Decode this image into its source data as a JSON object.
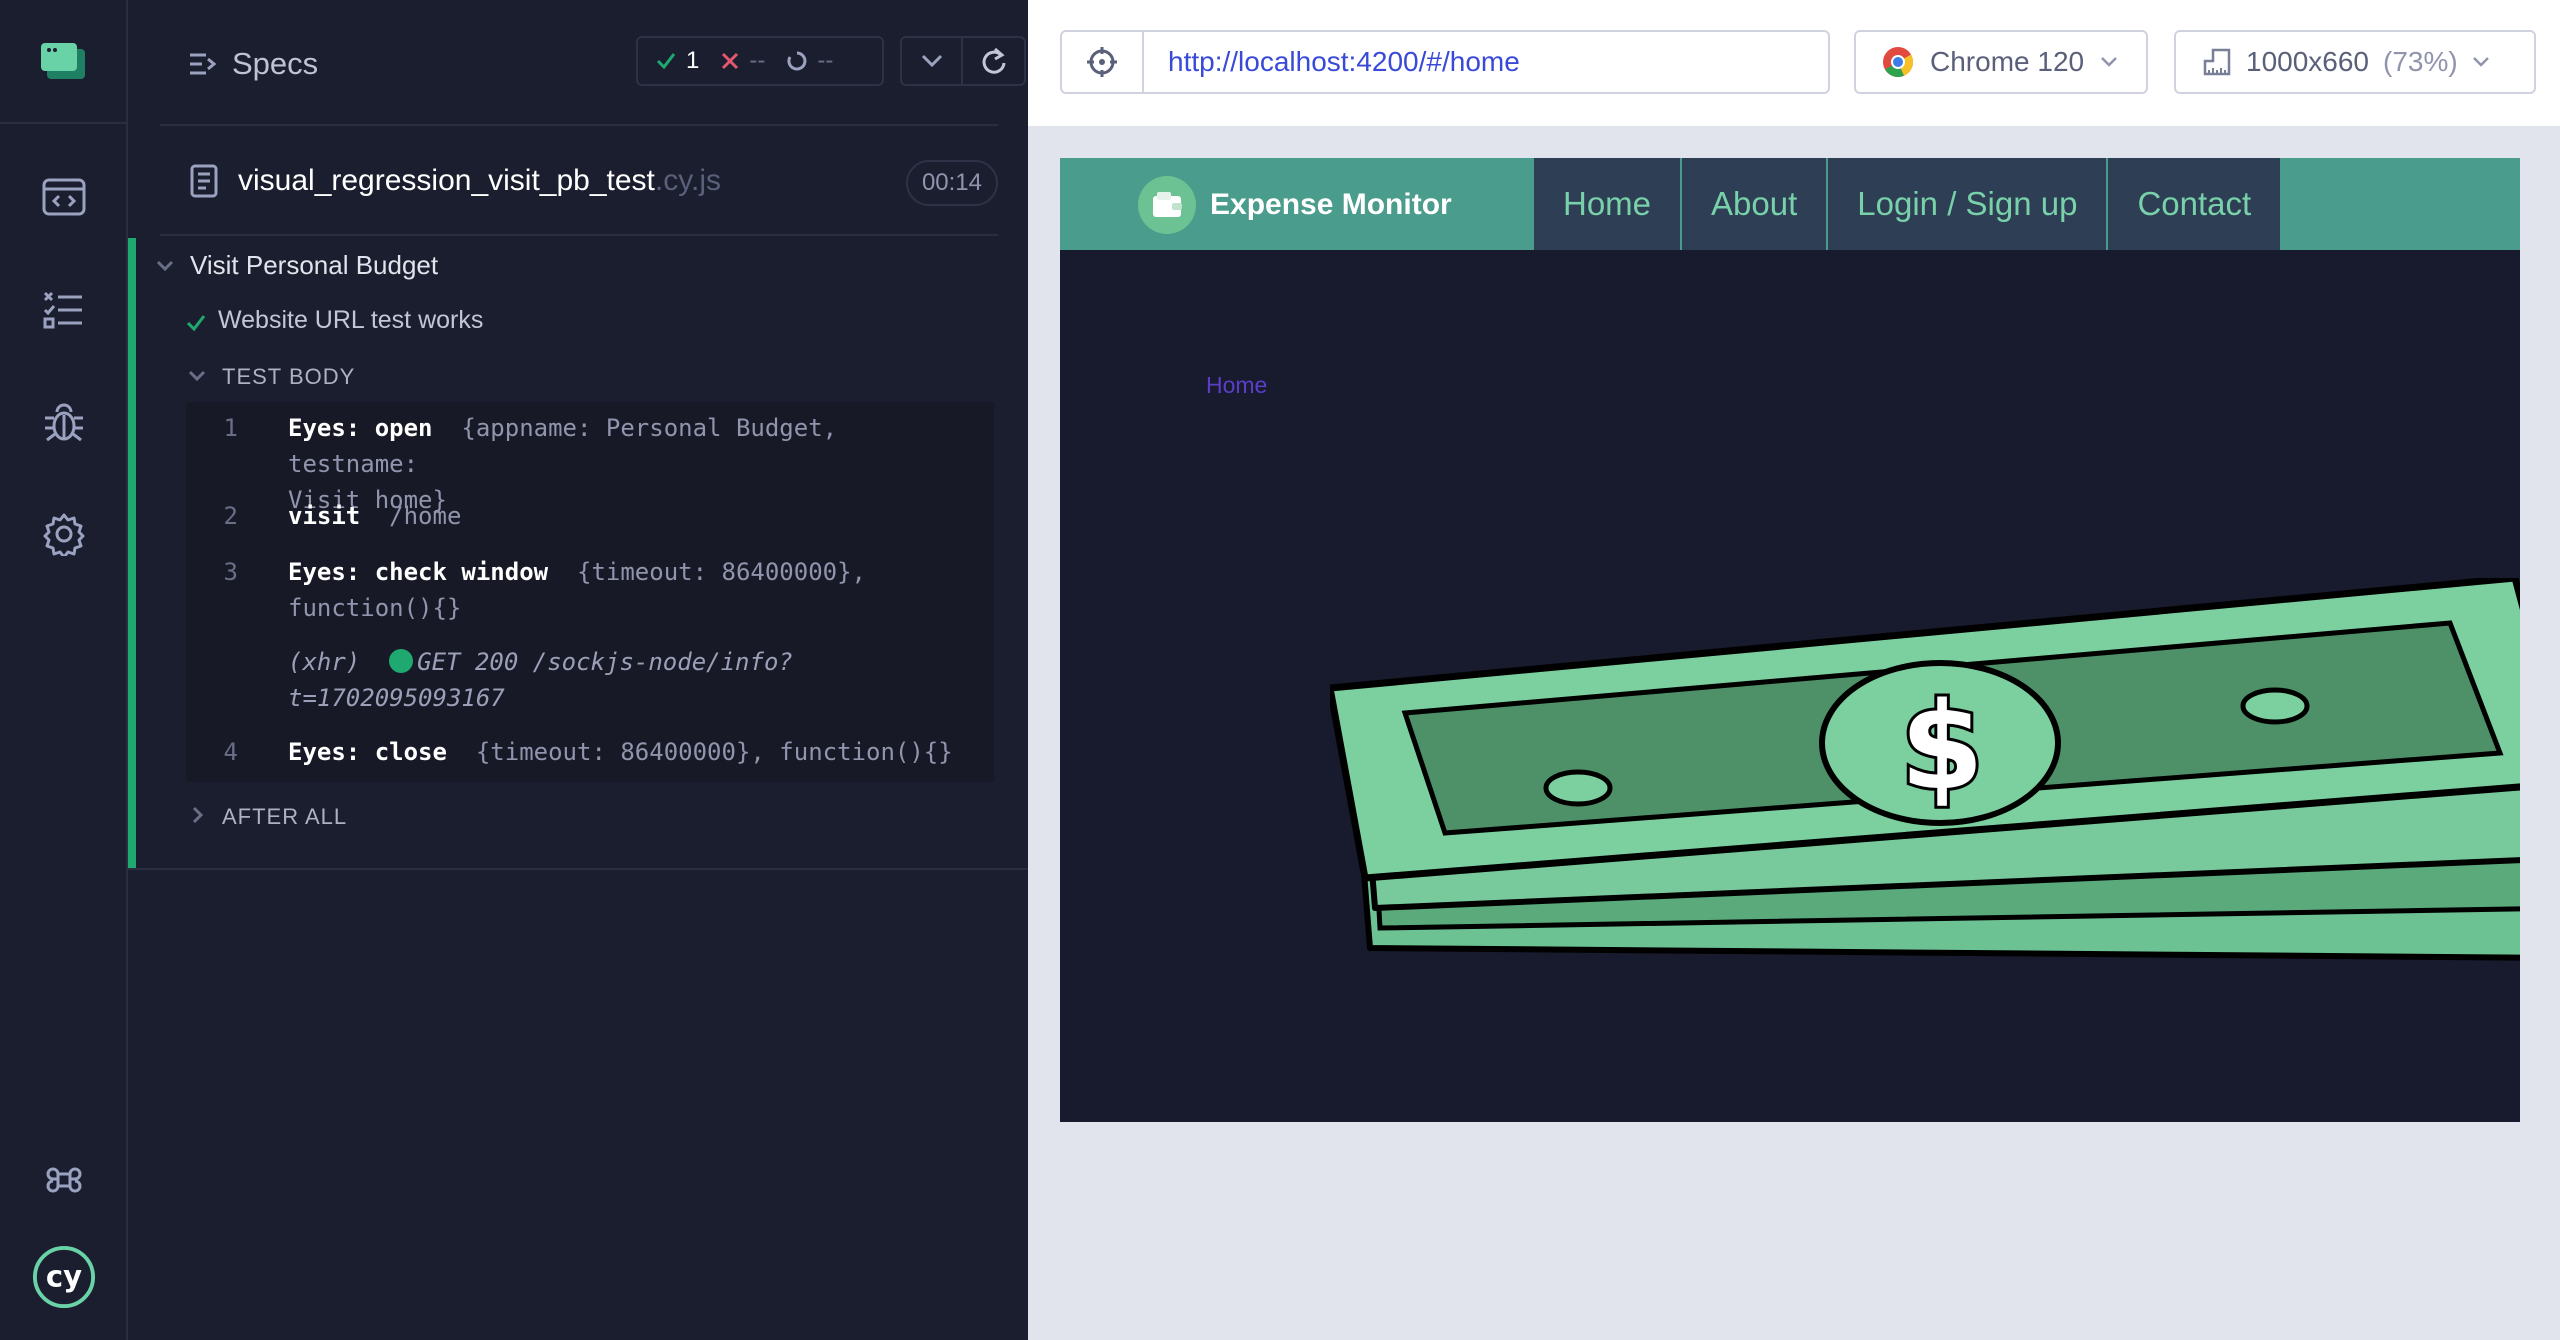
{
  "reporter": {
    "title": "Specs",
    "stats": {
      "passed": "1",
      "failed": "--",
      "pending": "--"
    },
    "spec": {
      "name": "visual_regression_visit_pb_test",
      "ext": ".cy.js",
      "duration": "00:14"
    },
    "suite": {
      "title": "Visit Personal Budget",
      "test": "Website URL test works",
      "test_body_label": "TEST BODY",
      "after_all_label": "AFTER ALL",
      "commands": [
        {
          "num": "1",
          "name": "Eyes: open",
          "arg": "{appname: Personal Budget, testname:",
          "arg2": "Visit home}"
        },
        {
          "num": "2",
          "name": "visit",
          "arg": "/home"
        },
        {
          "num": "3",
          "name": "Eyes: check window",
          "arg": "{timeout: 86400000},",
          "arg2": "function(){}"
        },
        {
          "num": "",
          "name": "(xhr)",
          "arg": "GET 200 /sockjs-node/info?",
          "arg2": "t=1702095093167"
        },
        {
          "num": "4",
          "name": "Eyes: close",
          "arg": "{timeout: 86400000}, function(){}"
        }
      ]
    }
  },
  "aut": {
    "url": "http://localhost:4200/#/home",
    "browser": "Chrome 120",
    "viewport": "1000x660",
    "scale": "(73%)",
    "app": {
      "brand": "Expense Monitor",
      "links": [
        "Home",
        "About",
        "Login / Sign up",
        "Contact"
      ],
      "breadcrumb": "Home"
    }
  },
  "colors": {
    "pass": "#1fa971",
    "fail": "#e45770",
    "accent": "#4a9c8c",
    "link": "#78d1a9"
  }
}
